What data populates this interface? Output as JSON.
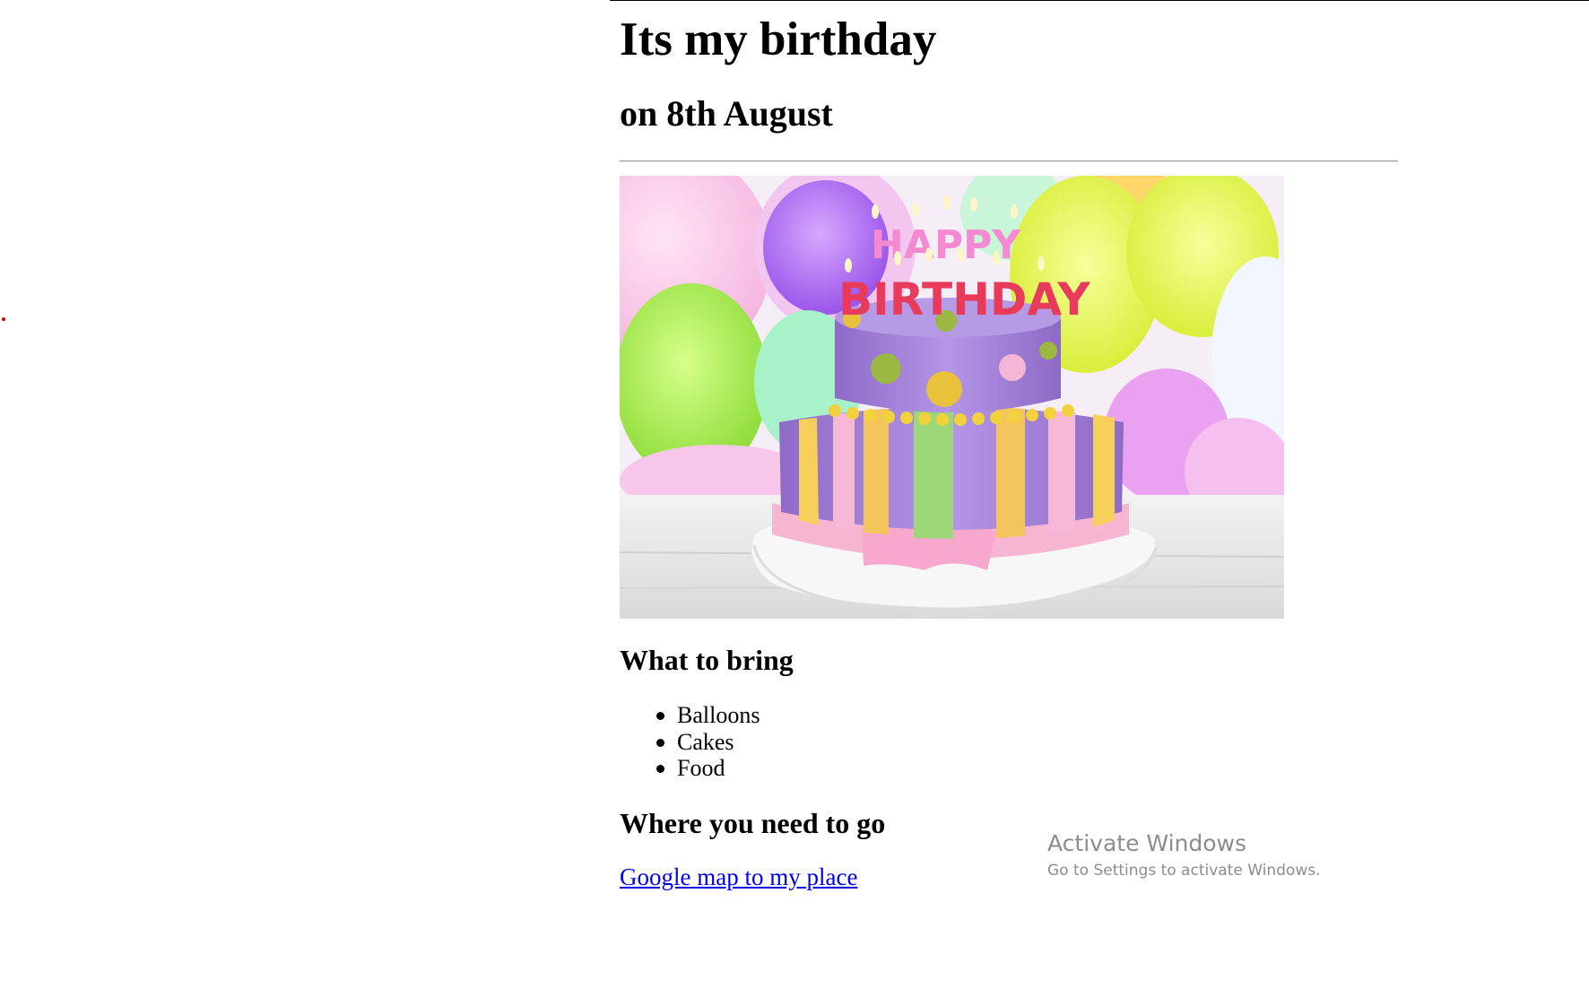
{
  "page": {
    "title": "Its my birthday",
    "subtitle": "on 8th August"
  },
  "image": {
    "candles_text_top": "HAPPY",
    "candles_text_bottom": "BIRTHDAY"
  },
  "bring": {
    "heading": "What to bring",
    "items": [
      "Balloons",
      "Cakes",
      "Food"
    ]
  },
  "location": {
    "heading": "Where you need to go",
    "link_text": "Google map to my place"
  },
  "watermark": {
    "title": "Activate Windows",
    "subtitle": "Go to Settings to activate Windows."
  },
  "colors": {
    "link": "#0000ee",
    "watermark": "#8c8c8c",
    "dot": "#d00000"
  }
}
